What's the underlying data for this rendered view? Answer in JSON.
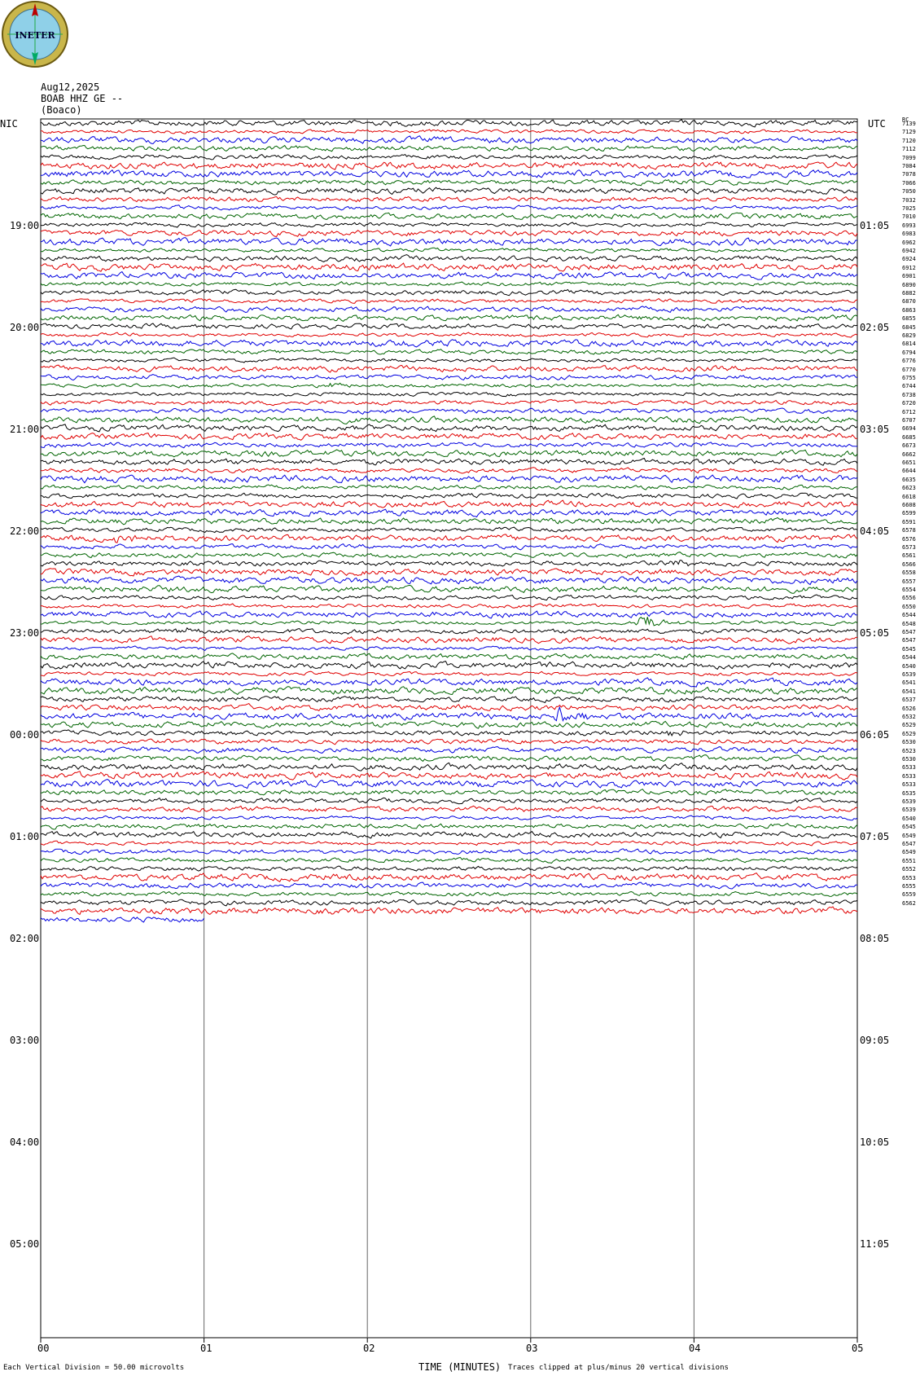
{
  "header": {
    "date": "Aug12,2025",
    "station": "BOAB HHZ GE --",
    "location": "(Boaco)",
    "logo_text": "INETER"
  },
  "left_axis": {
    "title": "NIC",
    "labels": [
      "19:00",
      "20:00",
      "21:00",
      "22:00",
      "23:00",
      "00:00",
      "01:00",
      "02:00",
      "03:00",
      "04:00",
      "05:00"
    ]
  },
  "right_axis": {
    "title": "UTC",
    "labels": [
      "01:05",
      "02:05",
      "03:05",
      "04:05",
      "05:05",
      "06:05",
      "07:05",
      "08:05",
      "09:05",
      "10:05",
      "11:05"
    ]
  },
  "row_counts_title": "RC",
  "footer": {
    "xlabel": "TIME (MINUTES)",
    "scale_note": "Each Vertical Division =   50.00 microvolts",
    "clip_note": "Traces clipped at plus/minus 20 vertical divisions"
  },
  "chart_data": {
    "type": "line",
    "title": "Aug12,2025 BOAB HHZ GE -- (Boaco)",
    "xlabel": "TIME (MINUTES)",
    "x_ticks": [
      "00",
      "01",
      "02",
      "03",
      "04",
      "05"
    ],
    "xlim": [
      0,
      5
    ],
    "grid_vertical": true,
    "trace_colors": [
      "#000000",
      "#e00000",
      "#0000e0",
      "#006400"
    ],
    "total_rows": 144,
    "filled_rows": 95,
    "row_minutes": 5,
    "row_counts": [
      7139,
      7129,
      7120,
      7112,
      7099,
      7084,
      7078,
      7066,
      7050,
      7032,
      7025,
      7010,
      6993,
      6983,
      6962,
      6942,
      6924,
      6912,
      6901,
      6890,
      6882,
      6870,
      6863,
      6855,
      6845,
      6829,
      6814,
      6794,
      6776,
      6770,
      6755,
      6744,
      6738,
      6720,
      6712,
      6707,
      6694,
      6685,
      6673,
      6662,
      6651,
      6644,
      6635,
      6623,
      6618,
      6608,
      6599,
      6591,
      6578,
      6576,
      6573,
      6561,
      6566,
      6558,
      6557,
      6554,
      6556,
      6550,
      6544,
      6548,
      6547,
      6547,
      6545,
      6544,
      6540,
      6539,
      6541,
      6541,
      6537,
      6526,
      6532,
      6529,
      6529,
      6530,
      6523,
      6530,
      6533,
      6533,
      6533,
      6535,
      6539,
      6539,
      6540,
      6545,
      6549,
      6547,
      6549,
      6551,
      6552,
      6553,
      6555,
      6559,
      6562
    ],
    "events": [
      {
        "row": 26,
        "minute": 2.2,
        "amplitude": 3
      },
      {
        "row": 31,
        "minute": 1.75,
        "amplitude": 4
      },
      {
        "row": 42,
        "minute": 0.25,
        "amplitude": 4
      },
      {
        "row": 49,
        "minute": 0.45,
        "amplitude": 5
      },
      {
        "row": 52,
        "minute": 3.85,
        "amplitude": 5
      },
      {
        "row": 59,
        "minute": 3.65,
        "amplitude": 14
      },
      {
        "row": 60,
        "minute": 0.85,
        "amplitude": 5
      },
      {
        "row": 70,
        "minute": 3.15,
        "amplitude": 12
      },
      {
        "row": 72,
        "minute": 3.82,
        "amplitude": 4
      }
    ]
  }
}
